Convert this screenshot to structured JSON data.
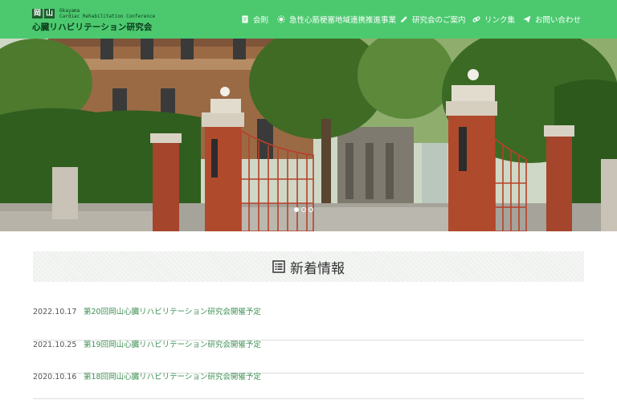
{
  "logo": {
    "box_chars": [
      "岡",
      "山"
    ],
    "english_lines": [
      "Okayama",
      "Cardiac Rehabilitation Conference"
    ],
    "japanese": "心臓リハビリテーション研究会"
  },
  "nav": [
    {
      "label": "会則",
      "icon": "document-icon"
    },
    {
      "label": "急性心筋梗塞地域連携推進事業",
      "icon": "sun-icon"
    },
    {
      "label": "研究会のご案内",
      "icon": "pencil-icon"
    },
    {
      "label": "リンク集",
      "icon": "link-icon"
    },
    {
      "label": "お問い合わせ",
      "icon": "paper-plane-icon"
    }
  ],
  "hero": {
    "slides": 3,
    "active_slide": 1
  },
  "news_section": {
    "title": "新着情報",
    "icon": "list-icon"
  },
  "news": [
    {
      "date": "2022.10.17",
      "title": "第20回岡山心臓リハビリテーション研究会開催予定"
    },
    {
      "date": "2021.10.25",
      "title": "第19回岡山心臓リハビリテーション研究会開催予定"
    },
    {
      "date": "2020.10.16",
      "title": "第18回岡山心臓リハビリテーション研究会開催予定"
    }
  ],
  "colors": {
    "header": "#4cc96f",
    "link": "#3e8f54",
    "logo_box": "#1f5a2e"
  }
}
